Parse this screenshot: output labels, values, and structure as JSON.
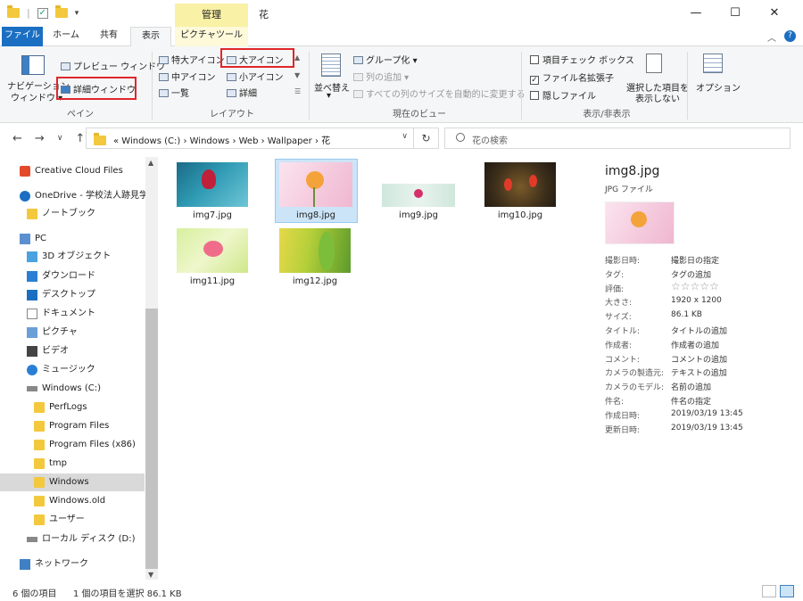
{
  "window": {
    "title": "花",
    "context_tab": "管理",
    "minimize_glyph": "—",
    "maximize_glyph": "☐",
    "close_glyph": "✕"
  },
  "ribbon_tabs": [
    "ファイル",
    "ホーム",
    "共有",
    "表示",
    "ピクチャツール"
  ],
  "ribbon": {
    "pane": {
      "nav_pane_line1": "ナビゲーション",
      "nav_pane_line2": "ウィンドウ ▾",
      "preview": "プレビュー ウィンドウ",
      "details": "詳細ウィンドウ",
      "label": "ペイン"
    },
    "layout": {
      "extra_large": "特大アイコン",
      "large": "大アイコン",
      "medium": "中アイコン",
      "small": "小アイコン",
      "list": "一覧",
      "detail": "詳細",
      "label": "レイアウト"
    },
    "current_view": {
      "sort_line1": "並べ替え",
      "sort_line2": "▾",
      "group_by": "グループ化 ▾",
      "add_columns": "列の追加 ▾",
      "fit_columns": "すべての列のサイズを自動的に変更する",
      "label": "現在のビュー"
    },
    "show_hide": {
      "item_checkbox": "項目チェック ボックス",
      "file_ext": "ファイル名拡張子",
      "hidden_files": "隠しファイル",
      "hide_selected_line1": "選択した項目を",
      "hide_selected_line2": "表示しない",
      "label": "表示/非表示"
    },
    "options": "オプション"
  },
  "address": {
    "path": "«  Windows (C:)  ›  Windows  ›  Web  ›  Wallpaper  ›  花",
    "search_placeholder": "花の検索"
  },
  "nav_items": [
    {
      "label": "Creative Cloud Files",
      "icon": "creative-cloud-icon"
    },
    {
      "label": "OneDrive - 学校法人跡見学",
      "icon": "onedrive-icon"
    },
    {
      "label": "ノートブック",
      "icon": "folder-icon"
    },
    {
      "label": "PC",
      "icon": "pc-icon"
    },
    {
      "label": "3D オブジェクト",
      "icon": "3d-objects-icon"
    },
    {
      "label": "ダウンロード",
      "icon": "download-icon"
    },
    {
      "label": "デスクトップ",
      "icon": "desktop-icon"
    },
    {
      "label": "ドキュメント",
      "icon": "document-icon"
    },
    {
      "label": "ピクチャ",
      "icon": "pictures-icon"
    },
    {
      "label": "ビデオ",
      "icon": "video-icon"
    },
    {
      "label": "ミュージック",
      "icon": "music-icon"
    },
    {
      "label": "Windows (C:)",
      "icon": "drive-icon"
    },
    {
      "label": "PerfLogs",
      "icon": "folder-icon"
    },
    {
      "label": "Program Files",
      "icon": "folder-icon"
    },
    {
      "label": "Program Files (x86)",
      "icon": "folder-icon"
    },
    {
      "label": "tmp",
      "icon": "folder-icon"
    },
    {
      "label": "Windows",
      "icon": "folder-icon"
    },
    {
      "label": "Windows.old",
      "icon": "folder-icon"
    },
    {
      "label": "ユーザー",
      "icon": "folder-icon"
    },
    {
      "label": "ローカル ディスク (D:)",
      "icon": "drive-icon"
    },
    {
      "label": "ネットワーク",
      "icon": "network-icon"
    }
  ],
  "files": [
    {
      "name": "img7.jpg"
    },
    {
      "name": "img8.jpg"
    },
    {
      "name": "img9.jpg"
    },
    {
      "name": "img10.jpg"
    },
    {
      "name": "img11.jpg"
    },
    {
      "name": "img12.jpg"
    }
  ],
  "details": {
    "title": "img8.jpg",
    "type": "JPG ファイル",
    "props": [
      {
        "label": "撮影日時:",
        "value": "撮影日の指定"
      },
      {
        "label": "タグ:",
        "value": "タグの追加"
      },
      {
        "label": "評価:",
        "value": "☆☆☆☆☆"
      },
      {
        "label": "大きさ:",
        "value": "1920 x 1200"
      },
      {
        "label": "サイズ:",
        "value": "86.1 KB"
      },
      {
        "label": "タイトル:",
        "value": "タイトルの追加"
      },
      {
        "label": "作成者:",
        "value": "作成者の追加"
      },
      {
        "label": "コメント:",
        "value": "コメントの追加"
      },
      {
        "label": "カメラの製造元:",
        "value": "テキストの追加"
      },
      {
        "label": "カメラのモデル:",
        "value": "名前の追加"
      },
      {
        "label": "件名:",
        "value": "件名の指定"
      },
      {
        "label": "作成日時:",
        "value": "2019/03/19 13:45"
      },
      {
        "label": "更新日時:",
        "value": "2019/03/19 13:45"
      }
    ]
  },
  "status": {
    "count": "6 個の項目",
    "selected": "1 個の項目を選択  86.1 KB"
  },
  "colors": {
    "accent": "#1b6fc2",
    "highlight": "#e0262a",
    "selection": "#cce4f7",
    "context_tab": "#f9f1a5"
  }
}
